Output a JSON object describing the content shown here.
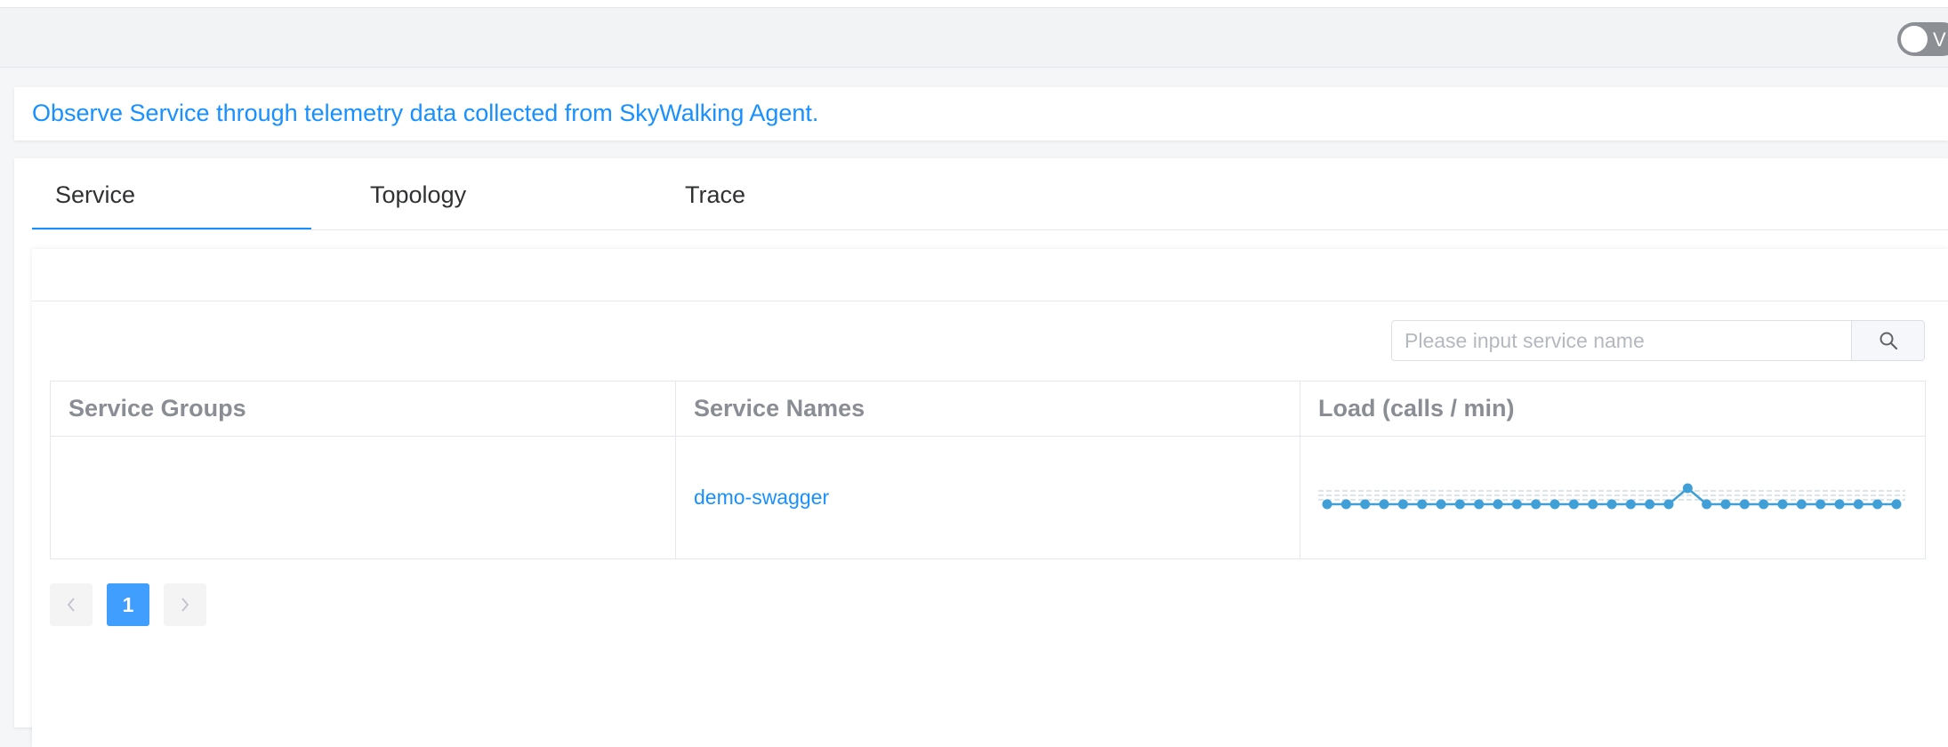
{
  "header": {
    "toggle_text": "V"
  },
  "banner": {
    "text": "Observe Service through telemetry data collected from SkyWalking Agent."
  },
  "tabs": [
    {
      "label": "Service",
      "active": true
    },
    {
      "label": "Topology",
      "active": false
    },
    {
      "label": "Trace",
      "active": false
    }
  ],
  "search": {
    "placeholder": "Please input service name",
    "value": "",
    "button_icon": "search-icon"
  },
  "table": {
    "columns": [
      "Service Groups",
      "Service Names",
      "Load (calls / min)"
    ],
    "rows": [
      {
        "group": "",
        "name": "demo-swagger",
        "load": [
          0,
          0,
          0,
          0,
          0,
          0,
          0,
          0,
          0,
          0,
          0,
          0,
          0,
          0,
          0,
          0,
          0,
          0,
          0,
          1,
          0,
          0,
          0,
          0,
          0,
          0,
          0,
          0,
          0,
          0,
          0
        ]
      }
    ]
  },
  "pagination": {
    "current_page": "1",
    "prev_icon": "chevron-left-icon",
    "next_icon": "chevron-right-icon"
  },
  "colors": {
    "accent": "#1890ff",
    "sparkline": "#3f9fd6",
    "active_page": "#409eff"
  }
}
